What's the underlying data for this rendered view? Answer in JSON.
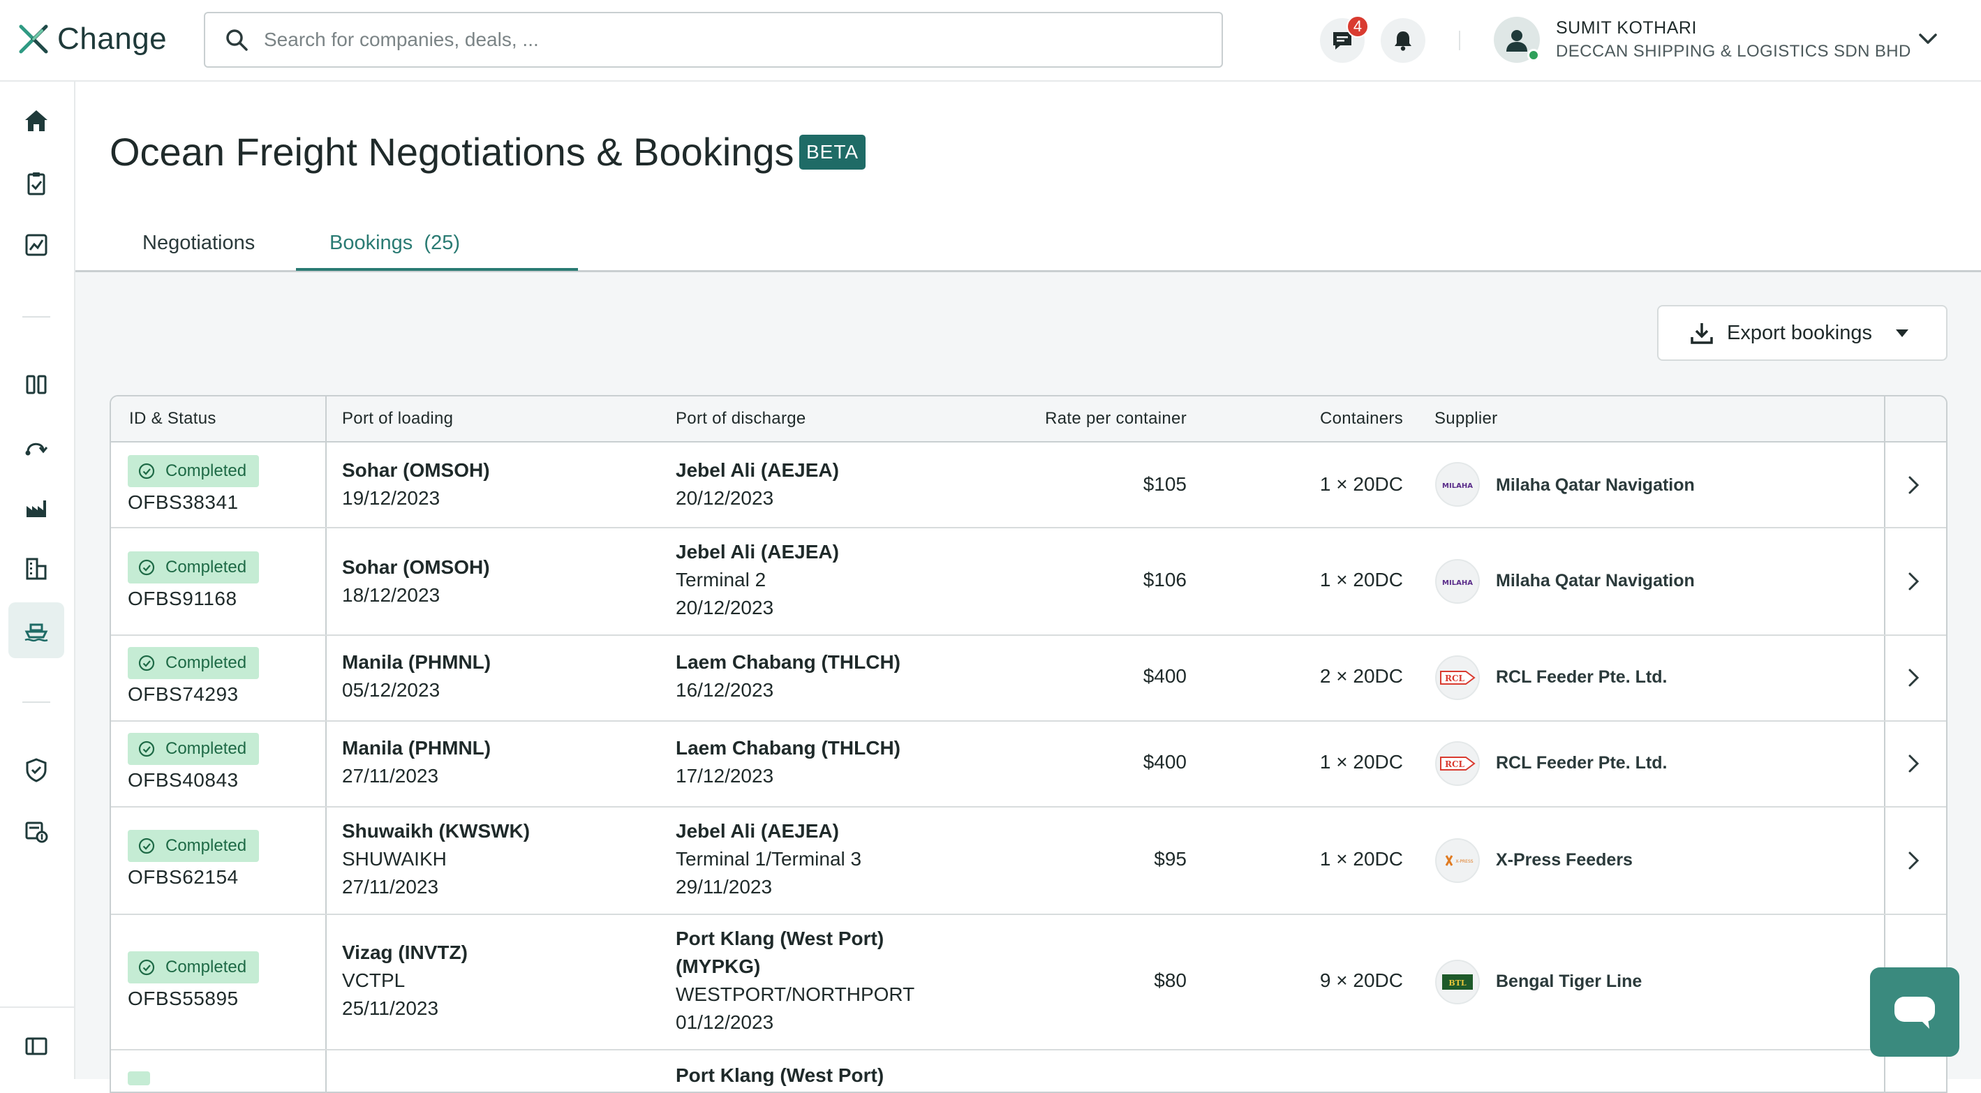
{
  "app": {
    "name": "Change"
  },
  "search": {
    "placeholder": "Search for companies, deals, ..."
  },
  "header": {
    "messages_count": "4",
    "user_name": "SUMIT KOTHARI",
    "user_company": "DECCAN SHIPPING & LOGISTICS SDN BHD"
  },
  "page": {
    "title": "Ocean Freight Negotiations & Bookings",
    "badge": "BETA",
    "tabs": [
      {
        "label": "Negotiations"
      },
      {
        "label": "Bookings  (25)"
      }
    ],
    "export_label": "Export bookings"
  },
  "table": {
    "headers": [
      "ID & Status",
      "Port of loading",
      "Port of discharge",
      "Rate per container",
      "Containers",
      "Supplier"
    ],
    "rows": [
      {
        "status": "Completed",
        "id": "OFBS38341",
        "loading_port": "Sohar (OMSOH)",
        "loading_sub": "",
        "loading_date": "19/12/2023",
        "discharge_port": "Jebel Ali (AEJEA)",
        "discharge_sub": "",
        "discharge_date": "20/12/2023",
        "rate": "$105",
        "containers": "1 × 20DC",
        "supplier": "Milaha Qatar Navigation",
        "supplier_logo": "MILAHA"
      },
      {
        "status": "Completed",
        "id": "OFBS91168",
        "loading_port": "Sohar (OMSOH)",
        "loading_sub": "",
        "loading_date": "18/12/2023",
        "discharge_port": "Jebel Ali (AEJEA)",
        "discharge_sub": "Terminal 2",
        "discharge_date": "20/12/2023",
        "rate": "$106",
        "containers": "1 × 20DC",
        "supplier": "Milaha Qatar Navigation",
        "supplier_logo": "MILAHA"
      },
      {
        "status": "Completed",
        "id": "OFBS74293",
        "loading_port": "Manila (PHMNL)",
        "loading_sub": "",
        "loading_date": "05/12/2023",
        "discharge_port": "Laem Chabang (THLCH)",
        "discharge_sub": "",
        "discharge_date": "16/12/2023",
        "rate": "$400",
        "containers": "2 × 20DC",
        "supplier": "RCL Feeder Pte. Ltd.",
        "supplier_logo": "RCL"
      },
      {
        "status": "Completed",
        "id": "OFBS40843",
        "loading_port": "Manila (PHMNL)",
        "loading_sub": "",
        "loading_date": "27/11/2023",
        "discharge_port": "Laem Chabang (THLCH)",
        "discharge_sub": "",
        "discharge_date": "17/12/2023",
        "rate": "$400",
        "containers": "1 × 20DC",
        "supplier": "RCL Feeder Pte. Ltd.",
        "supplier_logo": "RCL"
      },
      {
        "status": "Completed",
        "id": "OFBS62154",
        "loading_port": "Shuwaikh (KWSWK)",
        "loading_sub": "SHUWAIKH",
        "loading_date": "27/11/2023",
        "discharge_port": "Jebel Ali (AEJEA)",
        "discharge_sub": "Terminal 1/Terminal 3",
        "discharge_date": "29/11/2023",
        "rate": "$95",
        "containers": "1 × 20DC",
        "supplier": "X-Press Feeders",
        "supplier_logo": "X-PRESS"
      },
      {
        "status": "Completed",
        "id": "OFBS55895",
        "loading_port": "Vizag (INVTZ)",
        "loading_sub": "VCTPL",
        "loading_date": "25/11/2023",
        "discharge_port": "Port Klang (West Port)",
        "discharge_port2": "(MYPKG)",
        "discharge_sub": "WESTPORT/NORTHPORT",
        "discharge_date": "01/12/2023",
        "rate": "$80",
        "containers": "9 × 20DC",
        "supplier": "Bengal Tiger Line",
        "supplier_logo": "BTL"
      },
      {
        "discharge_port": "Port Klang (West Port)"
      }
    ]
  },
  "colors": {
    "brand": "#1f6b66",
    "accent": "#2a7b73",
    "status_bg": "#c5ecd4",
    "status_text": "#1e6a46",
    "badge_red": "#d93b30"
  }
}
